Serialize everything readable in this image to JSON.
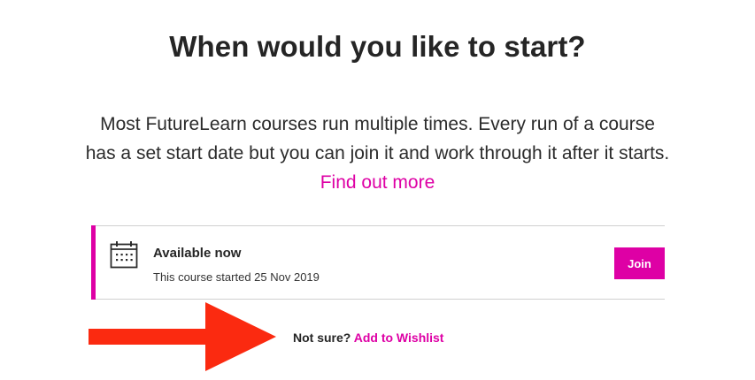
{
  "heading": "When would you like to start?",
  "intro": {
    "text": "Most FutureLearn courses run multiple times. Every run of a course has a set start date but you can join it and work through it after it starts.",
    "link_label": "Find out more"
  },
  "run": {
    "icon": "calendar-icon",
    "title": "Available now",
    "subtitle": "This course started 25 Nov 2019",
    "join_label": "Join"
  },
  "wishlist": {
    "prompt": "Not sure?",
    "link_label": "Add to Wishlist"
  },
  "colors": {
    "accent": "#de00a5",
    "annotation_arrow": "#fb2a10"
  }
}
